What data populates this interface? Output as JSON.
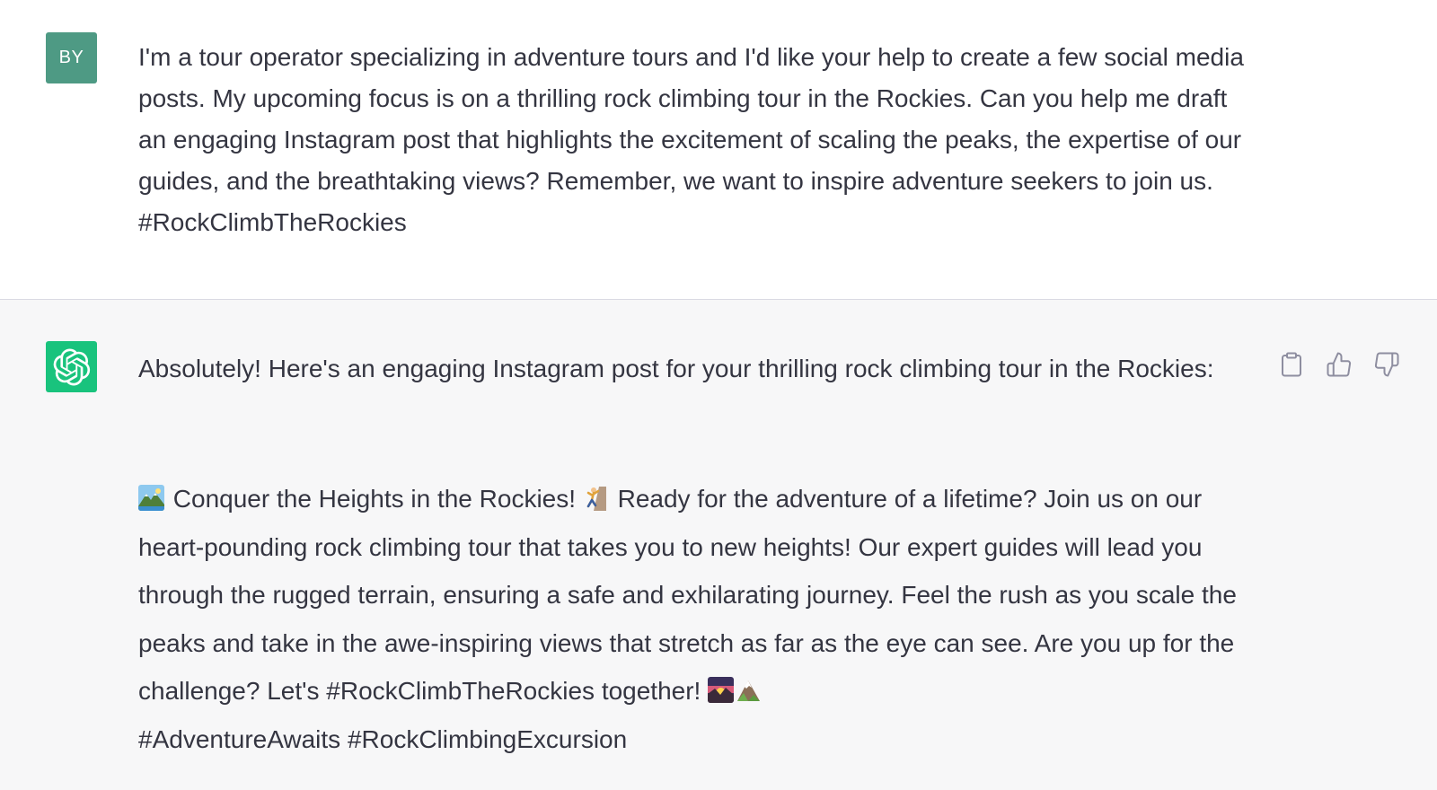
{
  "user": {
    "avatar_initials": "BY",
    "avatar_color": "#4e9a84",
    "message": " I'm a tour operator specializing in adventure tours and I'd like your help to create a few social media posts. My upcoming focus is on a thrilling rock climbing tour in the Rockies. Can you help me draft an engaging Instagram post that highlights the excitement of scaling the peaks, the expertise of our guides, and the breathtaking views? Remember, we want to inspire adventure seekers to join us. #RockClimbTheRockies"
  },
  "assistant": {
    "avatar_icon": "openai-logo-icon",
    "avatar_color": "#19c37d",
    "intro": "Absolutely! Here's an engaging Instagram post for your thrilling rock climbing tour in the Rockies:",
    "post": {
      "emoji_1": "mountain-landscape-emoji",
      "segment_1": " Conquer the Heights in the Rockies! ",
      "emoji_2": "person-climbing-emoji",
      "segment_2": " Ready for the adventure of a lifetime? Join us on our heart-pounding rock climbing tour that takes you to new heights! Our expert guides will lead you through the rugged terrain, ensuring a safe and exhilarating journey. Feel the rush as you scale the peaks and take in the awe-inspiring views that stretch as far as the eye can see. Are you up for the challenge? Let's #RockClimbTheRockies together! ",
      "emoji_3": "sunrise-over-mountains-emoji",
      "emoji_4": "snow-capped-mountain-emoji",
      "hashtags": "#AdventureAwaits #RockClimbingExcursion"
    },
    "actions": {
      "copy_icon": "clipboard-icon",
      "like_icon": "thumbs-up-icon",
      "dislike_icon": "thumbs-down-icon"
    }
  }
}
